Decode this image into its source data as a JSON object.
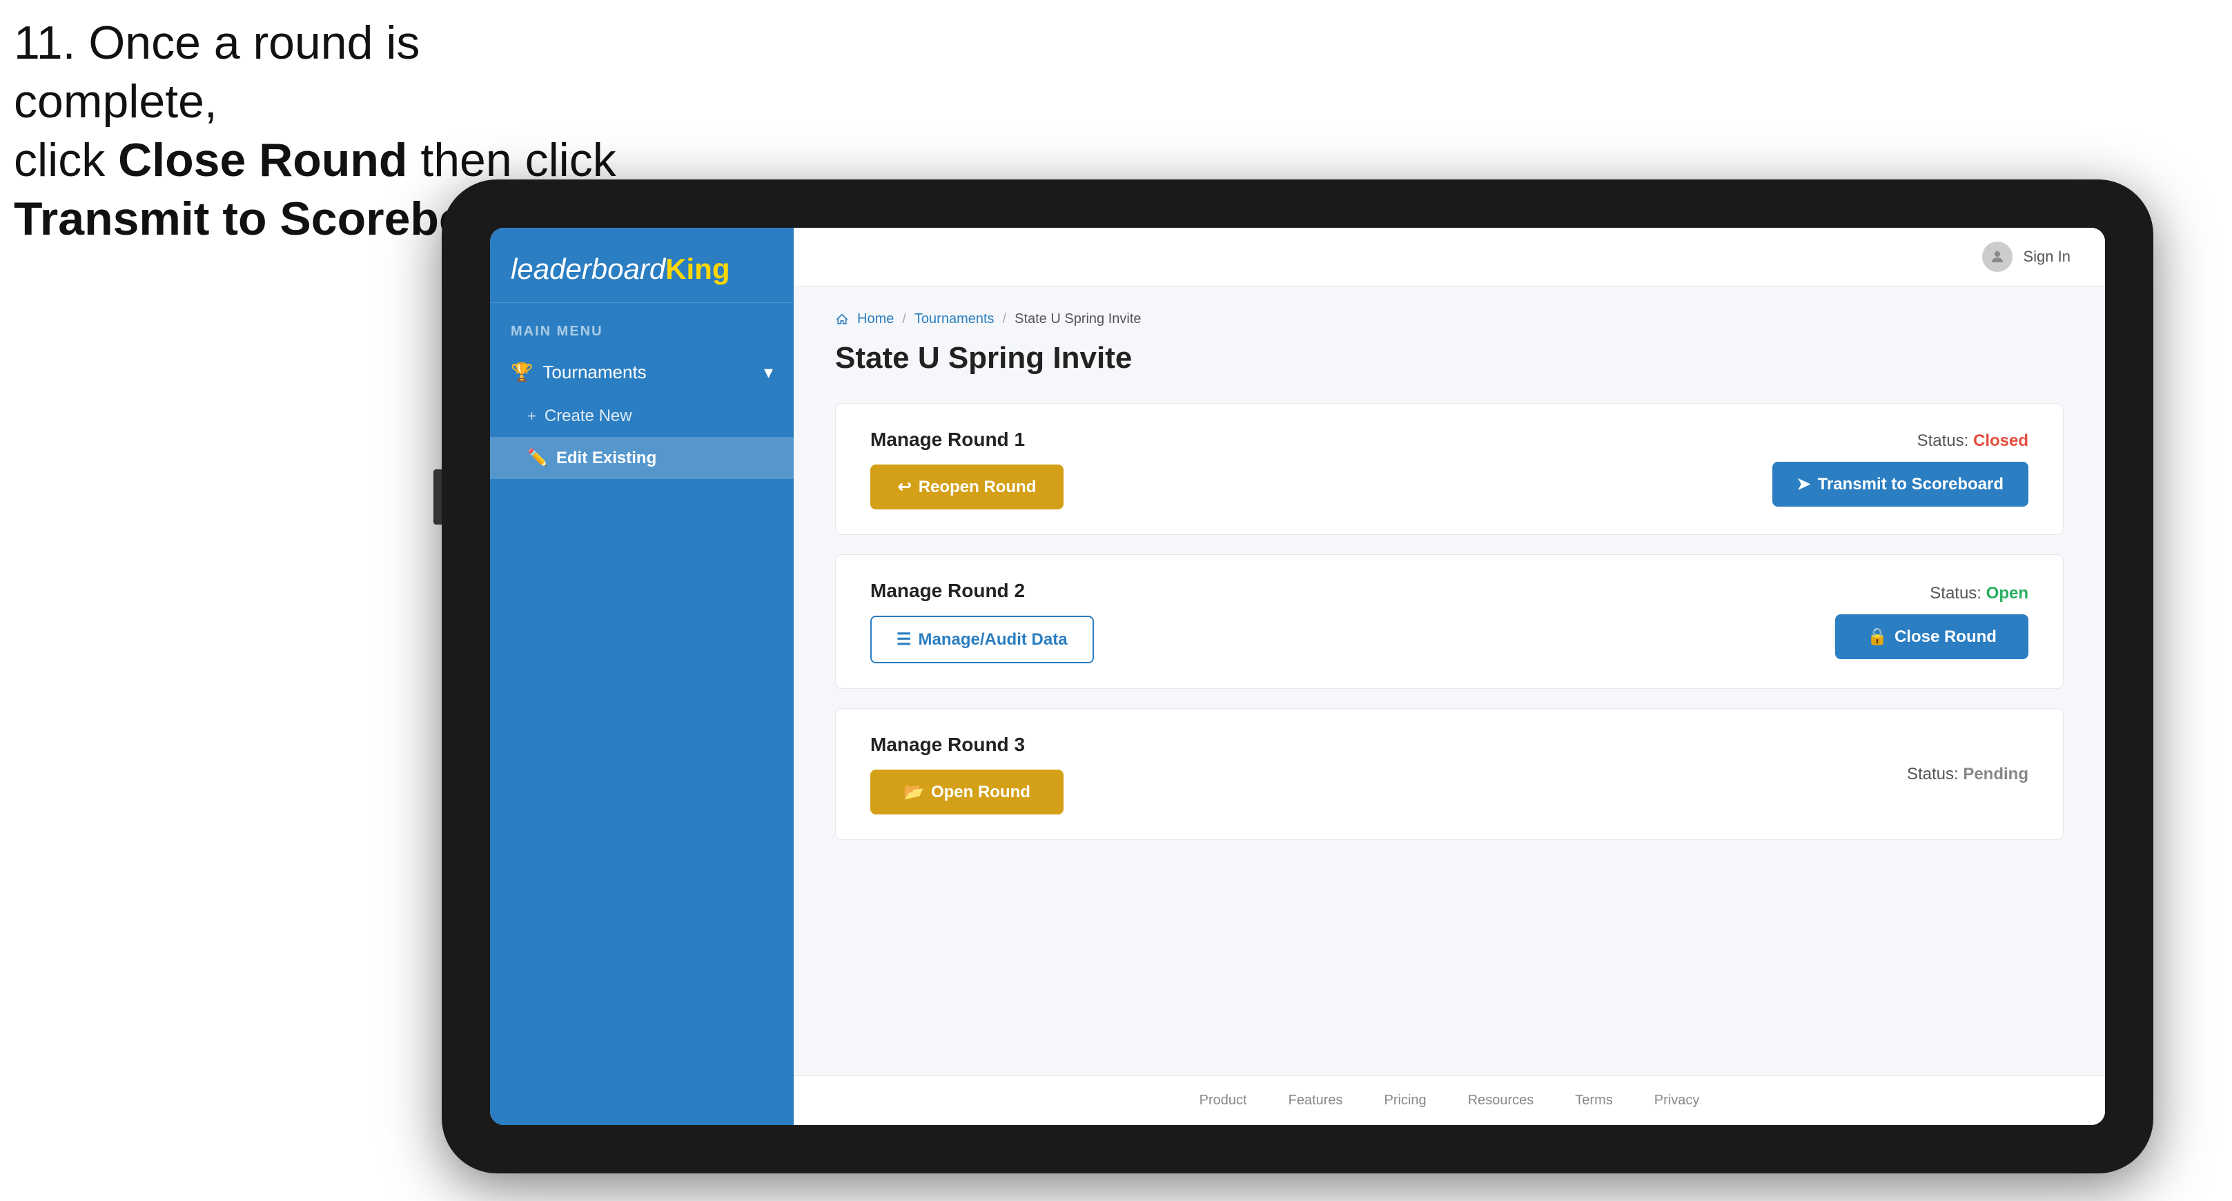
{
  "instruction": {
    "line1": "11. Once a round is complete,",
    "line2_prefix": "click ",
    "line2_bold": "Close Round",
    "line2_suffix": " then click",
    "line3_bold": "Transmit to Scoreboard."
  },
  "app": {
    "logo": {
      "leaderboard": "leaderboard",
      "king": "King"
    },
    "sidebar": {
      "menu_label": "MAIN MENU",
      "tournaments_label": "Tournaments",
      "create_new_label": "Create New",
      "edit_existing_label": "Edit Existing"
    },
    "topbar": {
      "sign_in_label": "Sign In"
    },
    "breadcrumb": {
      "home": "Home",
      "tournaments": "Tournaments",
      "current": "State U Spring Invite"
    },
    "page_title": "State U Spring Invite",
    "rounds": [
      {
        "id": "round1",
        "title": "Manage Round 1",
        "status_label": "Status:",
        "status_value": "Closed",
        "status_type": "closed",
        "button_label": "Reopen Round",
        "button_type": "gold",
        "right_button_label": "Transmit to Scoreboard",
        "right_button_type": "blue"
      },
      {
        "id": "round2",
        "title": "Manage Round 2",
        "status_label": "Status:",
        "status_value": "Open",
        "status_type": "open",
        "button_label": "Manage/Audit Data",
        "button_type": "outline",
        "right_button_label": "Close Round",
        "right_button_type": "blue"
      },
      {
        "id": "round3",
        "title": "Manage Round 3",
        "status_label": "Status:",
        "status_value": "Pending",
        "status_type": "pending",
        "button_label": "Open Round",
        "button_type": "gold",
        "right_button_label": null,
        "right_button_type": null
      }
    ],
    "footer": {
      "links": [
        "Product",
        "Features",
        "Pricing",
        "Resources",
        "Terms",
        "Privacy"
      ]
    }
  },
  "arrow": {
    "color": "#e8294c"
  }
}
